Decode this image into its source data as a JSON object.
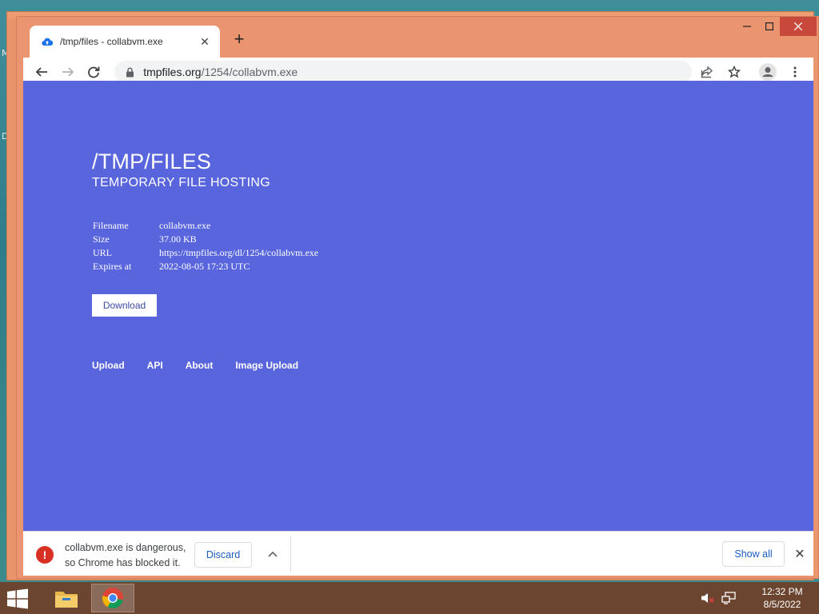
{
  "desktop": {
    "letters": [
      "M",
      "D"
    ]
  },
  "browser": {
    "tab_title": "/tmp/files - collabvm.exe",
    "new_tab_glyph": "+",
    "url_host": "tmpfiles.org",
    "url_path": "/1254/collabvm.exe",
    "icons": [
      "back-arrow-icon",
      "forward-arrow-icon",
      "reload-icon",
      "lock-icon",
      "share-icon",
      "star-icon",
      "profile-icon",
      "menu-dots-icon"
    ]
  },
  "page": {
    "title": "/TMP/FILES",
    "subtitle": "TEMPORARY FILE HOSTING",
    "info": [
      {
        "key": "Filename",
        "value": "collabvm.exe"
      },
      {
        "key": "Size",
        "value": "37.00 KB"
      },
      {
        "key": "URL",
        "value": "https://tmpfiles.org/dl/1254/collabvm.exe"
      },
      {
        "key": "Expires at",
        "value": "2022-08-05 17:23 UTC"
      }
    ],
    "download_label": "Download",
    "footer_links": [
      "Upload",
      "API",
      "About",
      "Image Upload"
    ],
    "background_color": "#5865dc"
  },
  "download_bar": {
    "message_line1": "collabvm.exe is dangerous,",
    "message_line2": "so Chrome has blocked it.",
    "discard_label": "Discard",
    "show_all_label": "Show all"
  },
  "taskbar": {
    "time": "12:32 PM",
    "date": "8/5/2022"
  }
}
